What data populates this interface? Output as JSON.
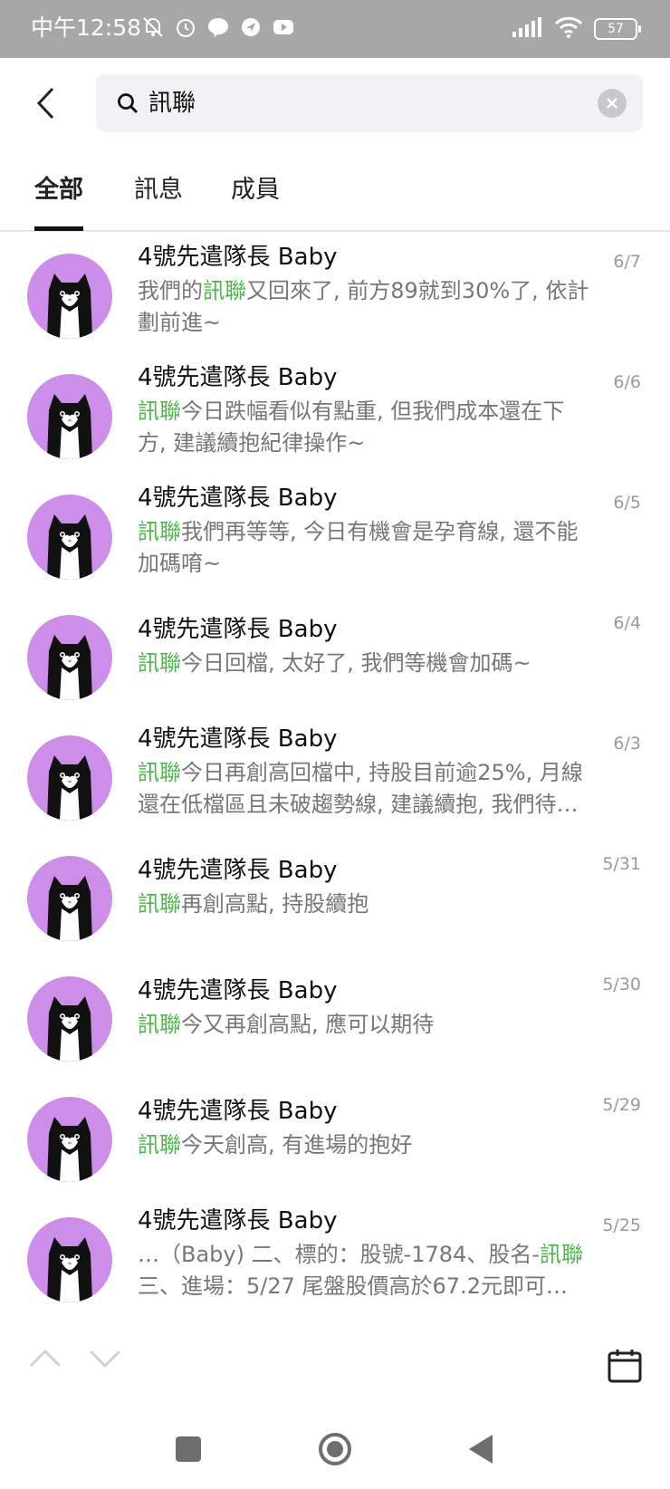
{
  "status_bar": {
    "time": "中午12:58",
    "battery": "57",
    "icons_left": [
      "mute-icon",
      "alarm-icon",
      "line-icon",
      "location-icon",
      "youtube-icon"
    ],
    "icons_right": [
      "signal-icon",
      "wifi-icon",
      "battery-icon"
    ]
  },
  "search": {
    "query": "訊聯"
  },
  "tabs": [
    {
      "label": "全部",
      "active": true
    },
    {
      "label": "訊息",
      "active": false
    },
    {
      "label": "成員",
      "active": false
    }
  ],
  "highlight_color": "#4db84a",
  "avatar_color": "#cc8ee8",
  "results": [
    {
      "name": "4號先遣隊長 Baby",
      "date": "6/7",
      "lines": [
        [
          [
            "我們的",
            false
          ],
          [
            "訊聯",
            true
          ],
          [
            "又回來了, 前方89就到30%了, 依計",
            false
          ]
        ],
        [
          [
            "劃前進~",
            false
          ]
        ]
      ]
    },
    {
      "name": "4號先遣隊長 Baby",
      "date": "6/6",
      "lines": [
        [
          [
            "訊聯",
            true
          ],
          [
            "今日跌幅看似有點重, 但我們成本還在下",
            false
          ]
        ],
        [
          [
            "方, 建議續抱紀律操作~",
            false
          ]
        ]
      ]
    },
    {
      "name": "4號先遣隊長 Baby",
      "date": "6/5",
      "lines": [
        [
          [
            "訊聯",
            true
          ],
          [
            "我們再等等, 今日有機會是孕育線, 還不能",
            false
          ]
        ],
        [
          [
            "加碼唷~",
            false
          ]
        ]
      ]
    },
    {
      "name": "4號先遣隊長 Baby",
      "date": "6/4",
      "lines": [
        [
          [
            "訊聯",
            true
          ],
          [
            "今日回檔, 太好了, 我們等機會加碼~",
            false
          ]
        ]
      ]
    },
    {
      "name": "4號先遣隊長 Baby",
      "date": "6/3",
      "lines": [
        [
          [
            "訊聯",
            true
          ],
          [
            "今日再創高回檔中, 持股目前逾25%, 月線",
            false
          ]
        ],
        [
          [
            "還在低檔區且未破趨勢線, 建議續抱, 我們待…",
            false
          ]
        ]
      ]
    },
    {
      "name": "4號先遣隊長 Baby",
      "date": "5/31",
      "lines": [
        [
          [
            "訊聯",
            true
          ],
          [
            "再創高點, 持股續抱",
            false
          ]
        ]
      ]
    },
    {
      "name": "4號先遣隊長 Baby",
      "date": "5/30",
      "lines": [
        [
          [
            "訊聯",
            true
          ],
          [
            "今又再創高點, 應可以期待",
            false
          ]
        ]
      ]
    },
    {
      "name": "4號先遣隊長 Baby",
      "date": "5/29",
      "lines": [
        [
          [
            "訊聯",
            true
          ],
          [
            "今天創高, 有進場的抱好",
            false
          ]
        ]
      ]
    },
    {
      "name": "4號先遣隊長 Baby",
      "date": "5/25",
      "lines": [
        [
          [
            "…（Baby) 二、標的：股號-1784、股名-",
            false
          ],
          [
            "訊聯",
            true
          ]
        ],
        [
          [
            "三、進場：5/27 尾盤股價高於67.2元即可…",
            false
          ]
        ]
      ]
    }
  ]
}
